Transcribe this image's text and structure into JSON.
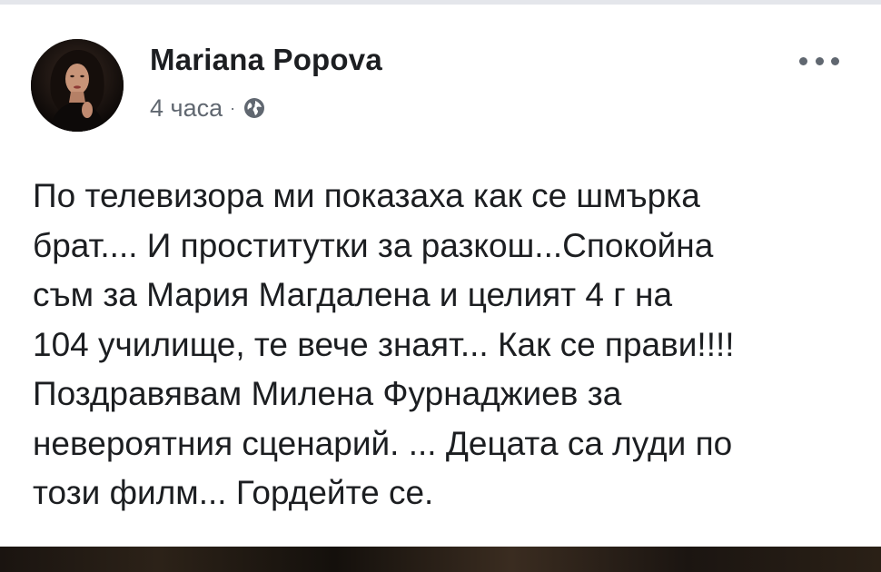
{
  "post": {
    "author": "Mariana Popova",
    "time": "4 часа",
    "separator": "·",
    "privacy_icon": "globe-icon",
    "more_icon": "more-dots-icon",
    "text": "По телевизора ми показаха как се шмърка\nбрат.... И проститутки за разкош...Спокойна\nсъм за Мария Магдалена и целият 4 г на\n104 училище, те вече знаят... Как се прави!!!!\nПоздравявам Милена Фурнаджиев за\nневероятния сценарий. ... Децата са луди по\nтози филм... Гордейте се."
  },
  "colors": {
    "name_text": "#1c1e21",
    "meta_text": "#606770",
    "background": "#ffffff",
    "top_strip": "#e4e6eb"
  }
}
